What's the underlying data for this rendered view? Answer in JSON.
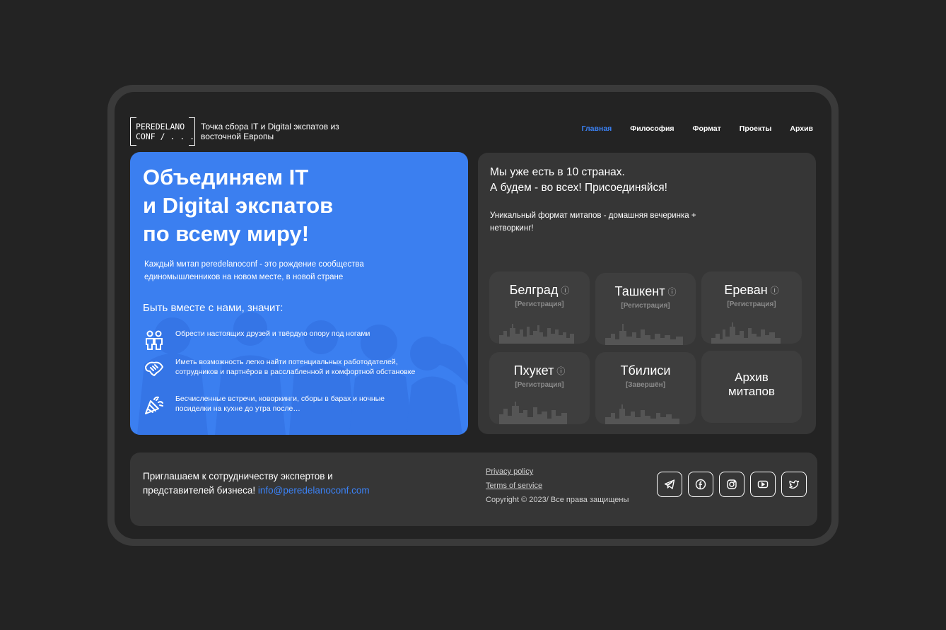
{
  "header": {
    "logo_line1": "PEREDELANO",
    "logo_line2": "CONF / . . .",
    "tagline": "Точка сбора IT и Digital экспатов из восточной Европы",
    "nav": [
      {
        "label": "Главная",
        "active": true
      },
      {
        "label": "Философия",
        "active": false
      },
      {
        "label": "Формат",
        "active": false
      },
      {
        "label": "Проекты",
        "active": false
      },
      {
        "label": "Архив",
        "active": false
      }
    ]
  },
  "hero": {
    "title_line1": "Объединяем IT",
    "title_line2": "и Digital экспатов",
    "title_line3": "по всему миру!",
    "lead": "Каждый митап peredelanoconf - это рождение сообщества единомышленников на новом месте, в новой стране",
    "subtitle": "Быть вместе с нами, значит:",
    "benefits": [
      {
        "icon": "friends-icon",
        "text": "Обрести настоящих друзей и твёрдую опору под ногами"
      },
      {
        "icon": "handshake-icon",
        "text": "Иметь возможность легко найти потенциальных работодателей, сотрудников и партнёров в расслабленной и комфортной обстановке"
      },
      {
        "icon": "party-popper-icon",
        "text": "Бесчисленные встречи, коворкинги, сборы в барах и ночные посиделки на кухне до утра после…"
      }
    ]
  },
  "panel": {
    "line1": "Мы уже есть в 10 странах.",
    "line2": "А будем - во всех! Присоединяйся!",
    "description": "Уникальный формат митапов - домашняя вечеринка + нетворкинг!",
    "cities": [
      {
        "name": "Белград",
        "status": "[Регистрация]",
        "info_icon": "ⓘ"
      },
      {
        "name": "Ташкент",
        "status": "[Регистрация]",
        "info_icon": "ⓘ"
      },
      {
        "name": "Ереван",
        "status": "[Регистрация]",
        "info_icon": "ⓘ"
      },
      {
        "name": "Пхукет",
        "status": "[Регистрация]",
        "info_icon": "ⓘ"
      },
      {
        "name": "Тбилиси",
        "status": "[Завершён]"
      }
    ],
    "archive_line1": "Архив",
    "archive_line2": "митапов"
  },
  "footer": {
    "invite_text": "Приглашаем к сотрудничеству экспертов и представителей бизнеса! ",
    "email": "info@peredelanoconf.com",
    "privacy": "Privacy policy",
    "terms": "Terms of service",
    "copyright": "Copyright © 2023/ Все права защищены",
    "socials": [
      "telegram-icon",
      "facebook-icon",
      "instagram-icon",
      "youtube-icon",
      "twitter-icon"
    ]
  },
  "colors": {
    "accent": "#3b82f6",
    "hero_bg": "#3b7ff0",
    "page_bg": "#232323",
    "panel_bg": "#363636",
    "card_bg": "#3e3e3e"
  }
}
